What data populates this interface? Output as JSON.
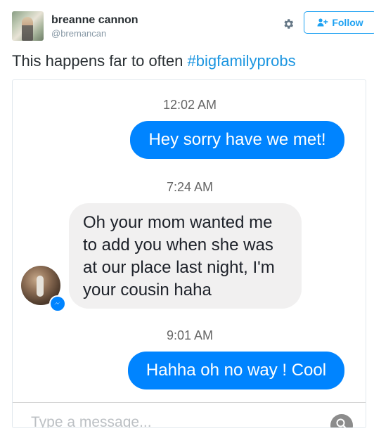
{
  "tweet": {
    "author": {
      "name": "breanne cannon",
      "handle": "@bremancan"
    },
    "actions": {
      "settings_icon": "gear-icon",
      "follow_label": "Follow"
    },
    "text": "This happens far to often ",
    "hashtag": "#bigfamilyprobs"
  },
  "messenger": {
    "messages": [
      {
        "time": "12:02 AM",
        "direction": "outgoing",
        "text": "Hey sorry have we met!"
      },
      {
        "time": "7:24 AM",
        "direction": "incoming",
        "text": "Oh your mom wanted me to add you when she was at our place last night, I'm your cousin haha"
      },
      {
        "time": "9:01 AM",
        "direction": "outgoing",
        "text": "Hahha oh no way ! Cool"
      }
    ],
    "composer": {
      "placeholder": "Type a message..."
    }
  },
  "colors": {
    "messenger_blue": "#0084ff",
    "twitter_blue": "#1da1f2",
    "hashtag_blue": "#1b95e0"
  }
}
